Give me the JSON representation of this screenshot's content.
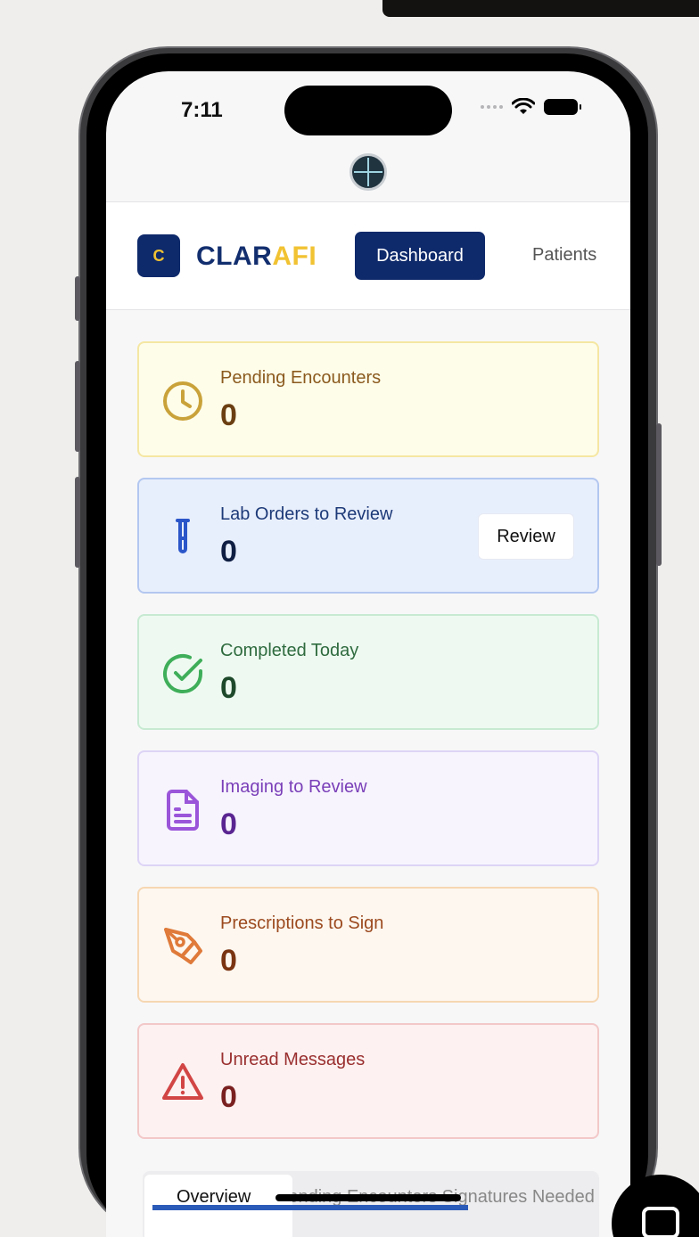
{
  "status_bar": {
    "time": "7:11"
  },
  "header": {
    "logo_letter": "C",
    "brand_main": "CLAR",
    "brand_accent": "AFI",
    "nav": [
      "Dashboard",
      "Patients"
    ]
  },
  "cards": [
    {
      "label": "Pending Encounters",
      "value": "0",
      "icon": "clock-icon",
      "bg": "#fefde9",
      "border": "#f5e7a3",
      "label_color": "#8b5a1e",
      "value_color": "#6b3f12",
      "icon_color": "#c9a23a"
    },
    {
      "label": "Lab Orders to Review",
      "value": "0",
      "icon": "test-tube-icon",
      "bg": "#e8effc",
      "border": "#b3c7f0",
      "label_color": "#1d3a78",
      "value_color": "#0f1e42",
      "icon_color": "#2b56c9",
      "action": "Review"
    },
    {
      "label": "Completed Today",
      "value": "0",
      "icon": "check-circle-icon",
      "bg": "#eefaf1",
      "border": "#c7ead2",
      "label_color": "#2f6b3f",
      "value_color": "#1e4a2b",
      "icon_color": "#3fae5a"
    },
    {
      "label": "Imaging to Review",
      "value": "0",
      "icon": "document-icon",
      "bg": "#f7f4fe",
      "border": "#ddd4f6",
      "label_color": "#7a3fb8",
      "value_color": "#5a2591",
      "icon_color": "#9a55d9"
    },
    {
      "label": "Prescriptions to Sign",
      "value": "0",
      "icon": "pen-icon",
      "bg": "#fdf7ef",
      "border": "#f6d7b2",
      "label_color": "#9c4a1f",
      "value_color": "#7a3411",
      "icon_color": "#df7a3a"
    },
    {
      "label": "Unread Messages",
      "value": "0",
      "icon": "warning-icon",
      "bg": "#fdf1f1",
      "border": "#f3c8c8",
      "label_color": "#9a2f2f",
      "value_color": "#7a2020",
      "icon_color": "#d24545"
    }
  ],
  "tabs": {
    "active": "Overview",
    "rest": "Pending Encounters    Signatures Needed"
  }
}
